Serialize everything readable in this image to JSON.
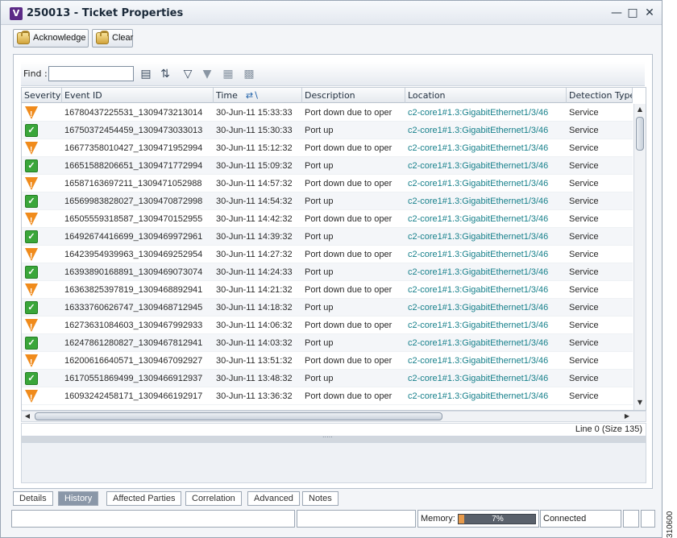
{
  "window": {
    "title": "250013 - Ticket Properties",
    "app_icon_letter": "V"
  },
  "toolbar": {
    "acknowledge_label": "Acknowledge",
    "clear_label": "Clear"
  },
  "find": {
    "label": "Find :",
    "value": ""
  },
  "table": {
    "columns": [
      "Severity",
      "Event ID",
      "Time",
      "Description",
      "Location",
      "Detection Type"
    ],
    "rows": [
      {
        "severity": "warning",
        "event_id": "16780437225531_1309473213014",
        "time": "30-Jun-11 15:33:33",
        "description": "Port down due to oper",
        "location": "c2-core1#1.3:GigabitEthernet1/3/46",
        "detection_type": "Service"
      },
      {
        "severity": "ok",
        "event_id": "16750372454459_1309473033013",
        "time": "30-Jun-11 15:30:33",
        "description": "Port up",
        "location": "c2-core1#1.3:GigabitEthernet1/3/46",
        "detection_type": "Service"
      },
      {
        "severity": "warning",
        "event_id": "16677358010427_1309471952994",
        "time": "30-Jun-11 15:12:32",
        "description": "Port down due to oper",
        "location": "c2-core1#1.3:GigabitEthernet1/3/46",
        "detection_type": "Service"
      },
      {
        "severity": "ok",
        "event_id": "16651588206651_1309471772994",
        "time": "30-Jun-11 15:09:32",
        "description": "Port up",
        "location": "c2-core1#1.3:GigabitEthernet1/3/46",
        "detection_type": "Service"
      },
      {
        "severity": "warning",
        "event_id": "16587163697211_1309471052988",
        "time": "30-Jun-11 14:57:32",
        "description": "Port down due to oper",
        "location": "c2-core1#1.3:GigabitEthernet1/3/46",
        "detection_type": "Service"
      },
      {
        "severity": "ok",
        "event_id": "16569983828027_1309470872998",
        "time": "30-Jun-11 14:54:32",
        "description": "Port up",
        "location": "c2-core1#1.3:GigabitEthernet1/3/46",
        "detection_type": "Service"
      },
      {
        "severity": "warning",
        "event_id": "16505559318587_1309470152955",
        "time": "30-Jun-11 14:42:32",
        "description": "Port down due to oper",
        "location": "c2-core1#1.3:GigabitEthernet1/3/46",
        "detection_type": "Service"
      },
      {
        "severity": "ok",
        "event_id": "16492674416699_1309469972961",
        "time": "30-Jun-11 14:39:32",
        "description": "Port up",
        "location": "c2-core1#1.3:GigabitEthernet1/3/46",
        "detection_type": "Service"
      },
      {
        "severity": "warning",
        "event_id": "16423954939963_1309469252954",
        "time": "30-Jun-11 14:27:32",
        "description": "Port down due to oper",
        "location": "c2-core1#1.3:GigabitEthernet1/3/46",
        "detection_type": "Service"
      },
      {
        "severity": "ok",
        "event_id": "16393890168891_1309469073074",
        "time": "30-Jun-11 14:24:33",
        "description": "Port up",
        "location": "c2-core1#1.3:GigabitEthernet1/3/46",
        "detection_type": "Service"
      },
      {
        "severity": "warning",
        "event_id": "16363825397819_1309468892941",
        "time": "30-Jun-11 14:21:32",
        "description": "Port down due to oper",
        "location": "c2-core1#1.3:GigabitEthernet1/3/46",
        "detection_type": "Service"
      },
      {
        "severity": "ok",
        "event_id": "16333760626747_1309468712945",
        "time": "30-Jun-11 14:18:32",
        "description": "Port up",
        "location": "c2-core1#1.3:GigabitEthernet1/3/46",
        "detection_type": "Service"
      },
      {
        "severity": "warning",
        "event_id": "16273631084603_1309467992933",
        "time": "30-Jun-11 14:06:32",
        "description": "Port down due to oper",
        "location": "c2-core1#1.3:GigabitEthernet1/3/46",
        "detection_type": "Service"
      },
      {
        "severity": "ok",
        "event_id": "16247861280827_1309467812941",
        "time": "30-Jun-11 14:03:32",
        "description": "Port up",
        "location": "c2-core1#1.3:GigabitEthernet1/3/46",
        "detection_type": "Service"
      },
      {
        "severity": "warning",
        "event_id": "16200616640571_1309467092927",
        "time": "30-Jun-11 13:51:32",
        "description": "Port down due to oper",
        "location": "c2-core1#1.3:GigabitEthernet1/3/46",
        "detection_type": "Service"
      },
      {
        "severity": "ok",
        "event_id": "16170551869499_1309466912937",
        "time": "30-Jun-11 13:48:32",
        "description": "Port up",
        "location": "c2-core1#1.3:GigabitEthernet1/3/46",
        "detection_type": "Service"
      },
      {
        "severity": "warning",
        "event_id": "16093242458171_1309466192917",
        "time": "30-Jun-11 13:36:32",
        "description": "Port down due to oper",
        "location": "c2-core1#1.3:GigabitEthernet1/3/46",
        "detection_type": "Service"
      }
    ],
    "line_status": "Line 0 (Size 135)"
  },
  "tabs": [
    {
      "label": "Details",
      "active": false
    },
    {
      "label": "History",
      "active": true
    },
    {
      "label": "Affected Parties",
      "active": false
    },
    {
      "label": "Correlation",
      "active": false
    },
    {
      "label": "Advanced",
      "active": false
    },
    {
      "label": "Notes",
      "active": false
    }
  ],
  "status": {
    "memory_label": "Memory:",
    "memory_value": "7%",
    "memory_fraction": 0.07,
    "connection": "Connected"
  },
  "figure_code": "310600",
  "colors": {
    "location_link": "#17808b",
    "warning": "#f08b1c",
    "ok": "#3aa63a"
  }
}
